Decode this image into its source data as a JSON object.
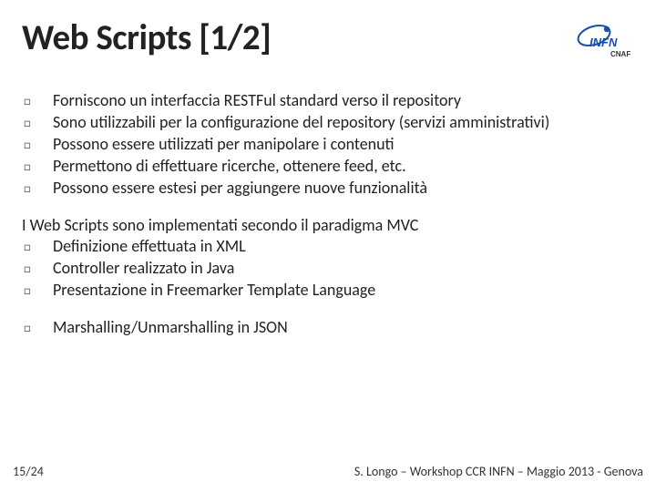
{
  "header": {
    "title": "Web Scripts [1/2]",
    "logo_main": "INFN",
    "logo_sub": "CNAF"
  },
  "block1": [
    "Forniscono un interfaccia RESTFul standard verso il repository",
    "Sono utilizzabili per la configurazione del repository (servizi amministrativi)",
    "Possono essere utilizzati per manipolare i contenuti",
    "Permettono di effettuare ricerche, ottenere feed, etc.",
    "Possono essere estesi per aggiungere nuove funzionalità"
  ],
  "block2_intro": "I Web Scripts sono implementati secondo il paradigma MVC",
  "block2": [
    "Definizione effettuata in XML",
    "Controller realizzato in Java",
    "Presentazione in Freemarker Template Language"
  ],
  "block3": [
    "Marshalling/Unmarshalling in JSON"
  ],
  "footer": {
    "page": "15/24",
    "text": "S. Longo – Workshop CCR INFN – Maggio 2013 - Genova"
  },
  "bullet_glyph": "□"
}
